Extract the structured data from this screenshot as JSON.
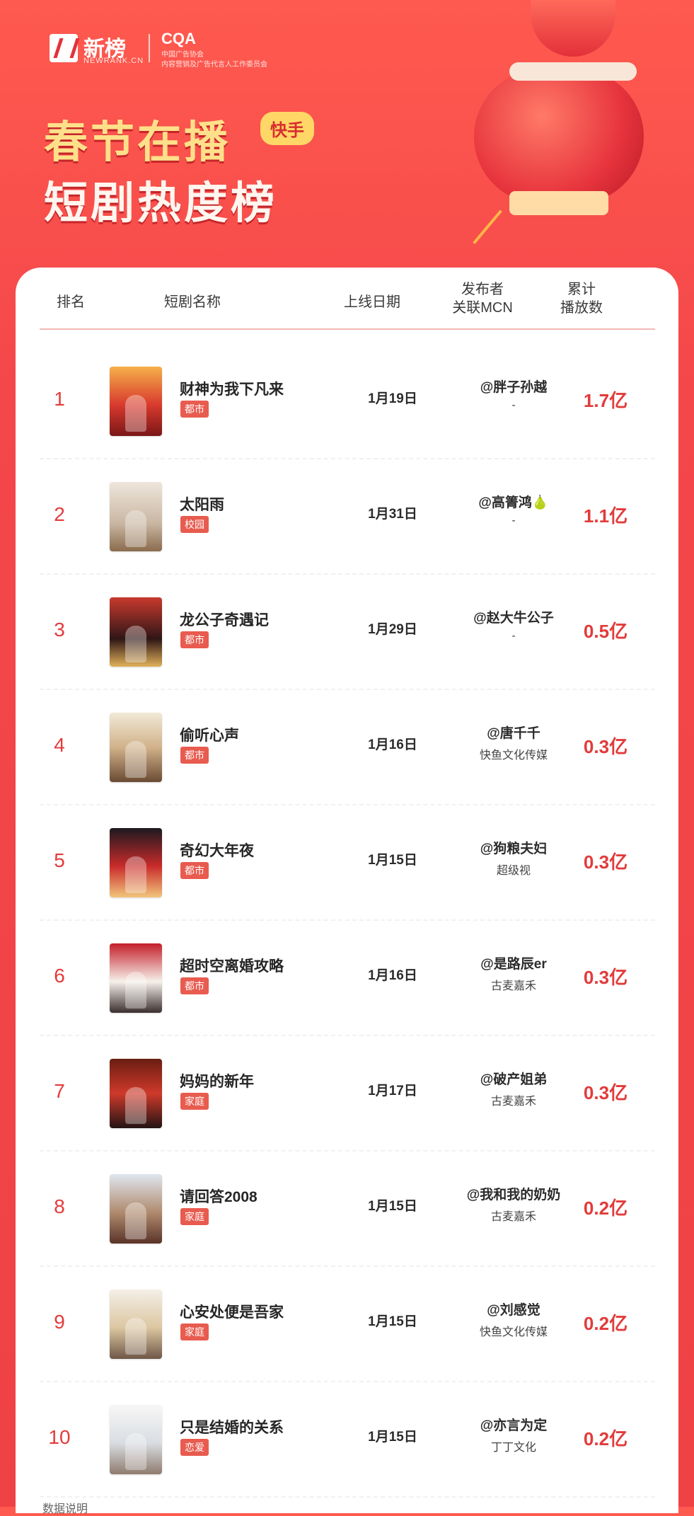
{
  "brand": {
    "name": "新榜",
    "sub": "NEWRANK.CN",
    "partner": "CQA",
    "partner_line1": "中国广告协会",
    "partner_line2": "内容营销及广告代言人工作委员会"
  },
  "title": {
    "line1": "春节在播",
    "line2": "短剧热度榜",
    "badge": "快手"
  },
  "table": {
    "headers": {
      "rank": "排名",
      "name": "短剧名称",
      "date": "上线日期",
      "publisher_line1": "发布者",
      "publisher_line2": "关联MCN",
      "plays_line1": "累计",
      "plays_line2": "播放数"
    },
    "rows": [
      {
        "rank": "1",
        "name": "财神为我下凡来",
        "tag": "都市",
        "date": "1月19日",
        "publisher": "@胖子孙越",
        "mcn": "-",
        "plays": "1.7亿"
      },
      {
        "rank": "2",
        "name": "太阳雨",
        "tag": "校园",
        "date": "1月31日",
        "publisher": "@高箐鸿🍐",
        "mcn": "-",
        "plays": "1.1亿"
      },
      {
        "rank": "3",
        "name": "龙公子奇遇记",
        "tag": "都市",
        "date": "1月29日",
        "publisher": "@赵大牛公子",
        "mcn": "-",
        "plays": "0.5亿"
      },
      {
        "rank": "4",
        "name": "偷听心声",
        "tag": "都市",
        "date": "1月16日",
        "publisher": "@唐千千",
        "mcn": "快鱼文化传媒",
        "plays": "0.3亿"
      },
      {
        "rank": "5",
        "name": "奇幻大年夜",
        "tag": "都市",
        "date": "1月15日",
        "publisher": "@狗粮夫妇",
        "mcn": "超级视",
        "plays": "0.3亿"
      },
      {
        "rank": "6",
        "name": "超时空离婚攻略",
        "tag": "都市",
        "date": "1月16日",
        "publisher": "@是路辰er",
        "mcn": "古麦嘉禾",
        "plays": "0.3亿"
      },
      {
        "rank": "7",
        "name": "妈妈的新年",
        "tag": "家庭",
        "date": "1月17日",
        "publisher": "@破产姐弟",
        "mcn": "古麦嘉禾",
        "plays": "0.3亿"
      },
      {
        "rank": "8",
        "name": "请回答2008",
        "tag": "家庭",
        "date": "1月15日",
        "publisher": "@我和我的奶奶",
        "mcn": "古麦嘉禾",
        "plays": "0.2亿"
      },
      {
        "rank": "9",
        "name": "心安处便是吾家",
        "tag": "家庭",
        "date": "1月15日",
        "publisher": "@刘感觉",
        "mcn": "快鱼文化传媒",
        "plays": "0.2亿"
      },
      {
        "rank": "10",
        "name": "只是结婚的关系",
        "tag": "恋爱",
        "date": "1月15日",
        "publisher": "@亦言为定",
        "mcn": "丁丁文化",
        "plays": "0.2亿"
      }
    ]
  },
  "footer": {
    "note": "数据说明"
  }
}
